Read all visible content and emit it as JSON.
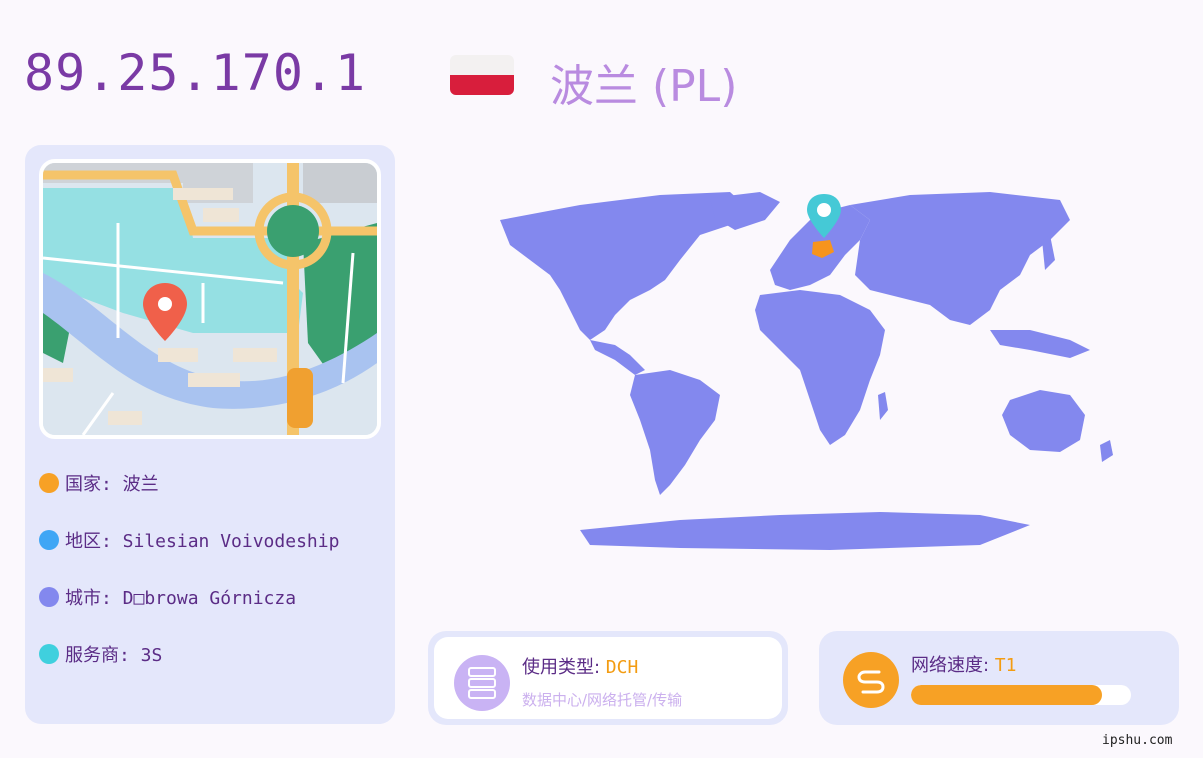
{
  "ip": "89.25.170.1",
  "country_title": "波兰 (PL)",
  "colors": {
    "accent_purple": "#7a3aa5",
    "country_color": "#b98be0",
    "map_fill": "#8388ee",
    "highlight": "#f7941d",
    "pin": "#45c9d6",
    "speed": "#f7a125"
  },
  "flag": {
    "icon": "poland-flag-icon"
  },
  "details": [
    {
      "label": "国家: 波兰",
      "color": "#f7a125"
    },
    {
      "label": "地区: Silesian Voivodeship",
      "color": "#3fa6f5"
    },
    {
      "label": "城市: D□browa Górnicza",
      "color": "#8388ee"
    },
    {
      "label": "服务商: 3S",
      "color": "#3fd0de"
    }
  ],
  "usage": {
    "label": "使用类型: ",
    "value": "DCH",
    "description": "数据中心/网络托管/传输",
    "icon": "server-icon"
  },
  "speed": {
    "label": "网络速度: ",
    "value": "T1",
    "level": 0.87,
    "icon": "speed-icon"
  },
  "watermark": "ipshu.com"
}
